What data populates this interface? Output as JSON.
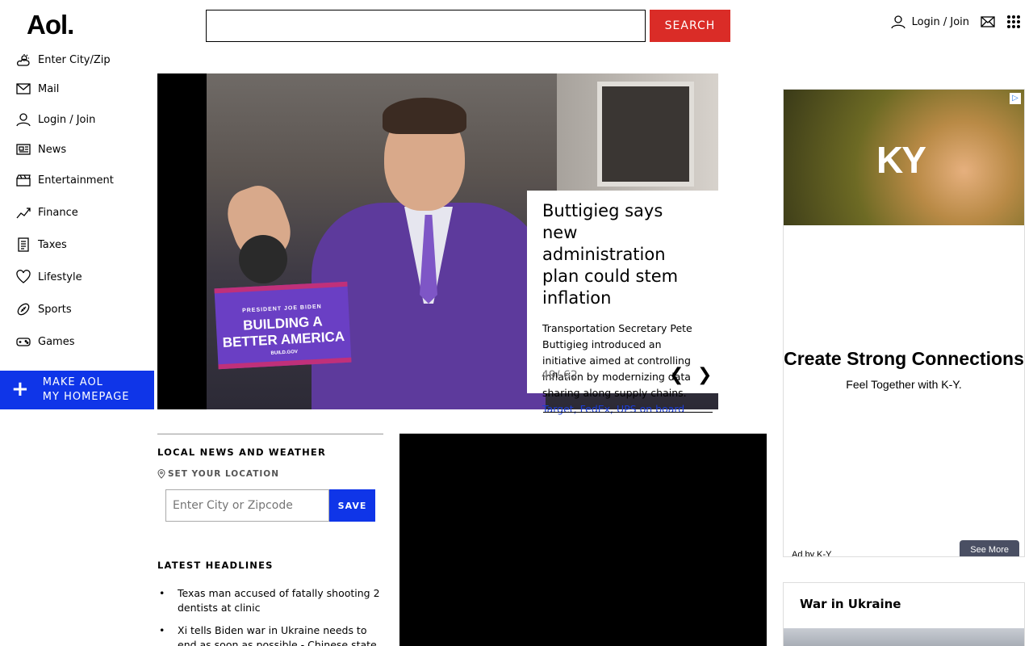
{
  "header": {
    "logo": "Aol.",
    "search_value": "",
    "search_label": "SEARCH",
    "login_label": "Login / Join"
  },
  "sidebar": {
    "items": [
      {
        "label": "Enter City/Zip",
        "icon": "weather-icon"
      },
      {
        "label": "Mail",
        "icon": "mail-icon"
      },
      {
        "label": "Login / Join",
        "icon": "user-icon"
      },
      {
        "label": "News",
        "icon": "news-icon"
      },
      {
        "label": "Entertainment",
        "icon": "clapperboard-icon"
      },
      {
        "label": "Finance",
        "icon": "chart-icon"
      },
      {
        "label": "Taxes",
        "icon": "tax-icon"
      },
      {
        "label": "Lifestyle",
        "icon": "heart-icon"
      },
      {
        "label": "Sports",
        "icon": "football-icon"
      },
      {
        "label": "Games",
        "icon": "gamepad-icon"
      }
    ],
    "make_home_line1": "MAKE AOL",
    "make_home_line2": "MY HOMEPAGE"
  },
  "hero": {
    "sign_small": "PRESIDENT JOE BIDEN",
    "sign_text": "BUILDING A BETTER AMERICA",
    "sign_tiny": "BUILD.GOV",
    "title": "Buttigieg says new administration plan could stem inflation",
    "description": "Transportation Secretary Pete Buttigieg introduced an initiative aimed at controlling inflation by modernizing data sharing along supply chains.",
    "link": "Target, FedEx, UPS on board",
    "counter": "49/ 62"
  },
  "local": {
    "title": "LOCAL NEWS AND WEATHER",
    "set_location": "SET YOUR LOCATION",
    "zip_placeholder": "Enter City or Zipcode",
    "save_label": "SAVE"
  },
  "headlines": {
    "title": "LATEST HEADLINES",
    "items": [
      "Texas man accused of fatally shooting 2 dentists at clinic",
      "Xi tells Biden war in Ukraine needs to end as soon as possible - Chinese state media"
    ]
  },
  "ad": {
    "logo": "KY",
    "headline": "Create Strong Connections",
    "subline": "Feel Together with K-Y.",
    "by": "Ad by K-Y",
    "more": "See More"
  },
  "ukraine": {
    "title": "War in Ukraine"
  }
}
